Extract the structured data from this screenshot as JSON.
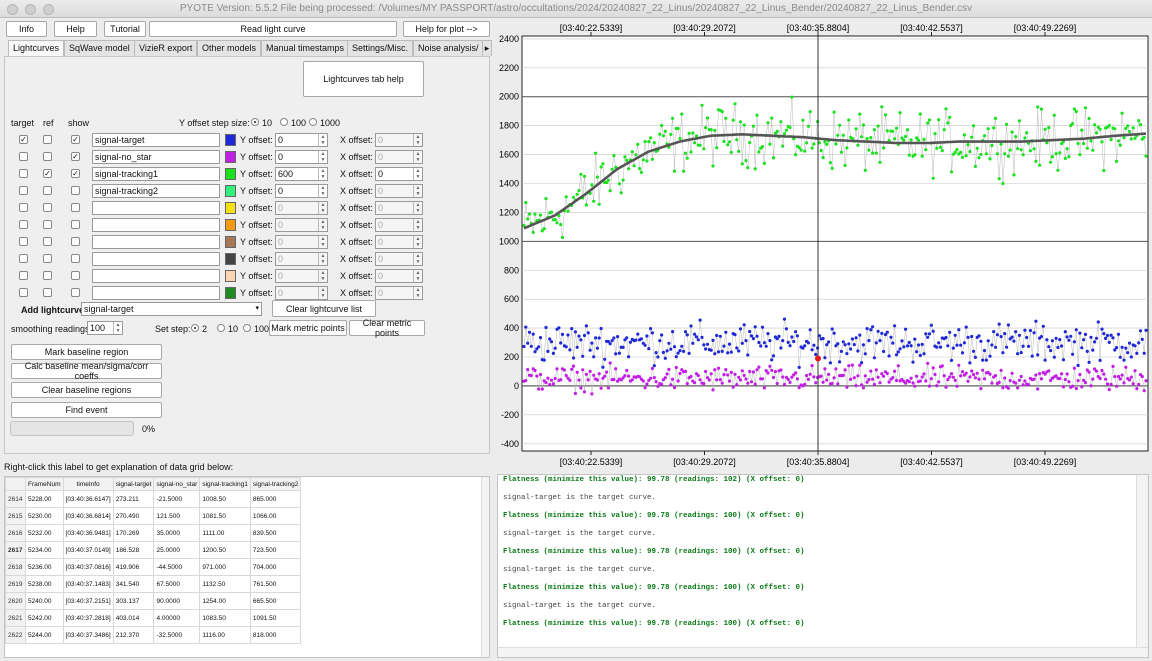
{
  "window": {
    "title": "PYOTE Version: 5.5.2  File being processed: /Volumes/MY PASSPORT/astro/occultations/2024/20240827_22_Linus/20240827_22_Linus_Bender/20240827_22_Linus_Bender.csv"
  },
  "toolbar": {
    "info": "Info",
    "help": "Help",
    "tutorial": "Tutorial",
    "read_light_curve": "Read light curve",
    "help_for_plot": "Help for plot -->"
  },
  "tabs": [
    "Lightcurves",
    "SqWave model",
    "VizieR export",
    "Other models",
    "Manual timestamps",
    "Settings/Misc.",
    "Noise analysis/"
  ],
  "tab_scroll_icon": "chevron-right-icon",
  "lightcurves_tab_help": "Lightcurves tab help",
  "headers": {
    "target": "target",
    "ref": "ref",
    "show": "show"
  },
  "y_offset_step": {
    "label": "Y offset step size:",
    "options": [
      "10",
      "100",
      "1000"
    ],
    "selected": "10"
  },
  "y_offset_label": "Y offset:",
  "x_offset_label": "X offset:",
  "curves": [
    {
      "name": "signal-target",
      "target": true,
      "ref": false,
      "show": true,
      "color": "#1f2ad6",
      "y": "0",
      "x": "0",
      "enabled": true
    },
    {
      "name": "signal-no_star",
      "target": false,
      "ref": false,
      "show": true,
      "color": "#c21ee6",
      "y": "0",
      "x": "0",
      "enabled": true
    },
    {
      "name": "signal-tracking1",
      "target": false,
      "ref": true,
      "show": true,
      "color": "#19e21e",
      "y": "600",
      "x": "0",
      "enabled": true
    },
    {
      "name": "signal-tracking2",
      "target": false,
      "ref": false,
      "show": false,
      "color": "#33f27c",
      "y": "0",
      "x": "0",
      "enabled": true
    },
    {
      "name": "",
      "target": false,
      "ref": false,
      "show": false,
      "color": "#f7e012",
      "y": "0",
      "x": "0",
      "enabled": false
    },
    {
      "name": "",
      "target": false,
      "ref": false,
      "show": false,
      "color": "#f49a14",
      "y": "0",
      "x": "0",
      "enabled": false
    },
    {
      "name": "",
      "target": false,
      "ref": false,
      "show": false,
      "color": "#a77857",
      "y": "0",
      "x": "0",
      "enabled": false
    },
    {
      "name": "",
      "target": false,
      "ref": false,
      "show": false,
      "color": "#444444",
      "y": "0",
      "x": "0",
      "enabled": false
    },
    {
      "name": "",
      "target": false,
      "ref": false,
      "show": false,
      "color": "#fbd5b3",
      "y": "0",
      "x": "0",
      "enabled": false
    },
    {
      "name": "",
      "target": false,
      "ref": false,
      "show": false,
      "color": "#1f8a1f",
      "y": "0",
      "x": "0",
      "enabled": false
    }
  ],
  "add_lightcurve": {
    "label": "Add lightcurve",
    "value": "signal-target"
  },
  "clear_lightcurve_list": "Clear lightcurve list",
  "smoothing": {
    "label": "smoothing readings",
    "value": "100"
  },
  "set_step": {
    "label": "Set step:",
    "options": [
      "2",
      "10",
      "100"
    ],
    "selected": "2"
  },
  "mark_metric_points": "Mark metric points",
  "clear_metric_points": "Clear metric points",
  "baseline_buttons": [
    "Mark baseline region",
    "Calc baseline mean/sigma/corr coeffs",
    "Clear baseline regions",
    "Find event"
  ],
  "progress": {
    "value": 0,
    "text": "0%"
  },
  "grid_label": "Right-click this label to get explanation of data grid below:",
  "grid": {
    "columns": [
      "FrameNum",
      "timeInfo",
      "signal-target",
      "signal-no_star",
      "signal-tracking1",
      "signal-tracking2"
    ],
    "rows": [
      {
        "n": "2614",
        "cells": [
          "5228.00",
          "[03:40:36.6147]",
          "273.211",
          "-21.5000",
          "1008.50",
          "865.000"
        ]
      },
      {
        "n": "2615",
        "cells": [
          "5230.00",
          "[03:40:36.6814]",
          "270.490",
          "121.500",
          "1081.50",
          "1066.00"
        ]
      },
      {
        "n": "2616",
        "cells": [
          "5232.00",
          "[03:40:36.9481]",
          "170.269",
          "35.0000",
          "1111.00",
          "839.500"
        ]
      },
      {
        "n": "2617",
        "cells": [
          "5234.00",
          "[03:40:37.0149]",
          "186.528",
          "25.0000",
          "1200.50",
          "723.500"
        ],
        "selected": true
      },
      {
        "n": "2618",
        "cells": [
          "5236.00",
          "[03:40:37.0816]",
          "419.906",
          "-44.5000",
          "971.000",
          "704.000"
        ]
      },
      {
        "n": "2619",
        "cells": [
          "5238.00",
          "[03:40:37.1483]",
          "341.540",
          "67.5000",
          "1132.50",
          "761.500"
        ]
      },
      {
        "n": "2620",
        "cells": [
          "5240.00",
          "[03:40:37.2151]",
          "303.137",
          "90.0000",
          "1254.00",
          "665.500"
        ]
      },
      {
        "n": "2621",
        "cells": [
          "5242.00",
          "[03:40:37.2818]",
          "403.014",
          "4.00000",
          "1083.50",
          "1091.50"
        ]
      },
      {
        "n": "2622",
        "cells": [
          "5244.00",
          "[03:40:37.3486]",
          "212.370",
          "-32.5000",
          "1116.00",
          "818.000"
        ]
      }
    ]
  },
  "log": [
    {
      "text": "Flatness (minimize this value): 99.78 (readings: 102) (X offset: 0)",
      "bold": true
    },
    {
      "text": "signal-target is the target curve.",
      "bold": false
    },
    {
      "text": "Flatness (minimize this value): 99.78 (readings: 100) (X offset: 0)",
      "bold": true
    },
    {
      "text": "signal-target is the target curve.",
      "bold": false
    },
    {
      "text": "Flatness (minimize this value): 99.78 (readings: 100) (X offset: 0)",
      "bold": true
    },
    {
      "text": "signal-target is the target curve.",
      "bold": false
    },
    {
      "text": "Flatness (minimize this value): 99.78 (readings: 100) (X offset: 0)",
      "bold": true
    },
    {
      "text": "signal-target is the target curve.",
      "bold": false
    },
    {
      "text": "Flatness (minimize this value): 99.78 (readings: 100) (X offset: 0)",
      "bold": true
    }
  ],
  "chart_data": {
    "type": "scatter",
    "title": "",
    "xlabel": "",
    "ylabel": "",
    "ylim": [
      -450,
      2420
    ],
    "yticks": [
      -400,
      -200,
      0,
      200,
      400,
      600,
      800,
      1000,
      1200,
      1400,
      1600,
      1800,
      2000,
      2200,
      2400
    ],
    "xticks_top": [
      "[03:40:22.5339]",
      "[03:40:29.2072]",
      "[03:40:35.8804]",
      "[03:40:42.5537]",
      "[03:40:49.2269]"
    ],
    "xticks_bottom": [
      "[03:40:22.5339]",
      "[03:40:29.2072]",
      "[03:40:35.8804]",
      "[03:40:42.5537]",
      "[03:40:49.2269]"
    ],
    "cursor_time": "[03:40:35.8804]",
    "grid": true,
    "series": [
      {
        "color": "#19e21e",
        "mean_start": 1080,
        "mean_plateau": 1720,
        "spread": 170
      },
      {
        "color": "#1f2ad6",
        "mean_start": 300,
        "mean_plateau": 300,
        "spread": 110
      },
      {
        "color": "#c21ee6",
        "mean_start": 50,
        "mean_plateau": 50,
        "spread": 70
      }
    ],
    "smoothed_curve": {
      "color": "#555555",
      "points": [
        [
          0,
          1090
        ],
        [
          0.05,
          1180
        ],
        [
          0.1,
          1330
        ],
        [
          0.15,
          1500
        ],
        [
          0.2,
          1620
        ],
        [
          0.25,
          1690
        ],
        [
          0.3,
          1730
        ],
        [
          0.35,
          1740
        ],
        [
          0.4,
          1730
        ],
        [
          0.45,
          1720
        ],
        [
          0.5,
          1700
        ],
        [
          0.55,
          1690
        ],
        [
          0.6,
          1680
        ],
        [
          0.65,
          1680
        ],
        [
          0.7,
          1690
        ],
        [
          0.75,
          1690
        ],
        [
          0.8,
          1690
        ],
        [
          0.85,
          1700
        ],
        [
          0.9,
          1710
        ],
        [
          0.95,
          1730
        ],
        [
          1,
          1745
        ]
      ]
    },
    "marked_point": {
      "color": "#e41a1a",
      "y": 190
    }
  }
}
